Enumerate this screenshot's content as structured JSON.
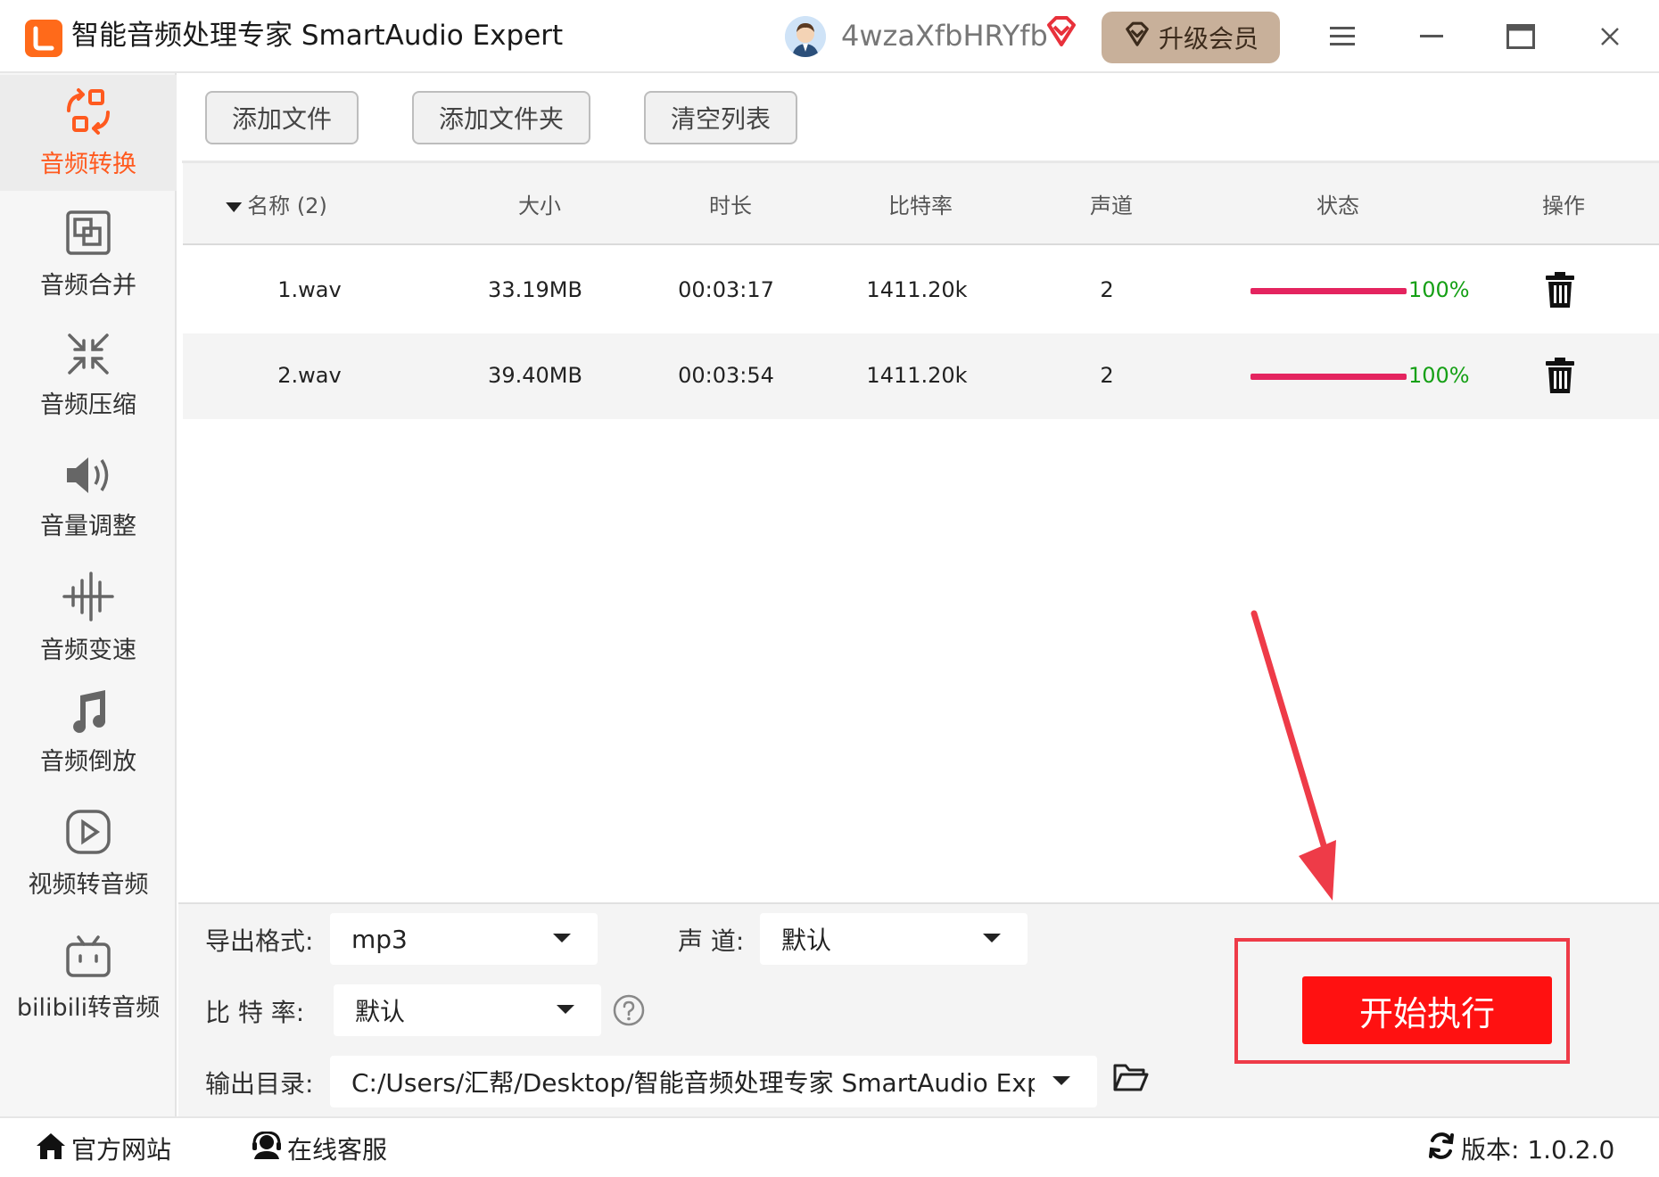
{
  "app": {
    "title": "智能音频处理专家 SmartAudio Expert",
    "username": "4wzaXfbHRYfb",
    "upgrade_label": "升级会员"
  },
  "sidebar": {
    "items": [
      {
        "label": "音频转换",
        "icon": "convert-icon",
        "active": true
      },
      {
        "label": "音频合并",
        "icon": "merge-icon"
      },
      {
        "label": "音频压缩",
        "icon": "compress-icon"
      },
      {
        "label": "音量调整",
        "icon": "volume-icon"
      },
      {
        "label": "音频变速",
        "icon": "speed-icon"
      },
      {
        "label": "音频倒放",
        "icon": "reverse-music-icon"
      },
      {
        "label": "视频转音频",
        "icon": "video-play-icon"
      },
      {
        "label": "bilibili转音频",
        "icon": "bilibili-tv-icon"
      }
    ]
  },
  "toolbar": {
    "add_file": "添加文件",
    "add_folder": "添加文件夹",
    "clear_list": "清空列表"
  },
  "table": {
    "columns": [
      "名称 (2)",
      "大小",
      "时长",
      "比特率",
      "声道",
      "状态",
      "操作"
    ],
    "rows": [
      {
        "name": "1.wav",
        "size": "33.19MB",
        "duration": "00:03:17",
        "bitrate": "1411.20k",
        "channels": "2",
        "progress": 100,
        "status": "100%"
      },
      {
        "name": "2.wav",
        "size": "39.40MB",
        "duration": "00:03:54",
        "bitrate": "1411.20k",
        "channels": "2",
        "progress": 100,
        "status": "100%"
      }
    ]
  },
  "options": {
    "format_label": "导出格式:",
    "format_value": "mp3",
    "channel_label": "声 道:",
    "channel_value": "默认",
    "bitrate_label": "比 特 率:",
    "bitrate_value": "默认",
    "output_label": "输出目录:",
    "output_value": "C:/Users/汇帮/Desktop/智能音频处理专家 SmartAudio Exp"
  },
  "start_button": "开始执行",
  "footer": {
    "website": "官方网站",
    "support": "在线客服",
    "version": "版本: 1.0.2.0"
  },
  "colors": {
    "accent": "#ff5a1f",
    "start_button": "#ff1111",
    "progress": "#e4245f",
    "status_text": "#16a016",
    "highlight": "#ee3b48"
  }
}
